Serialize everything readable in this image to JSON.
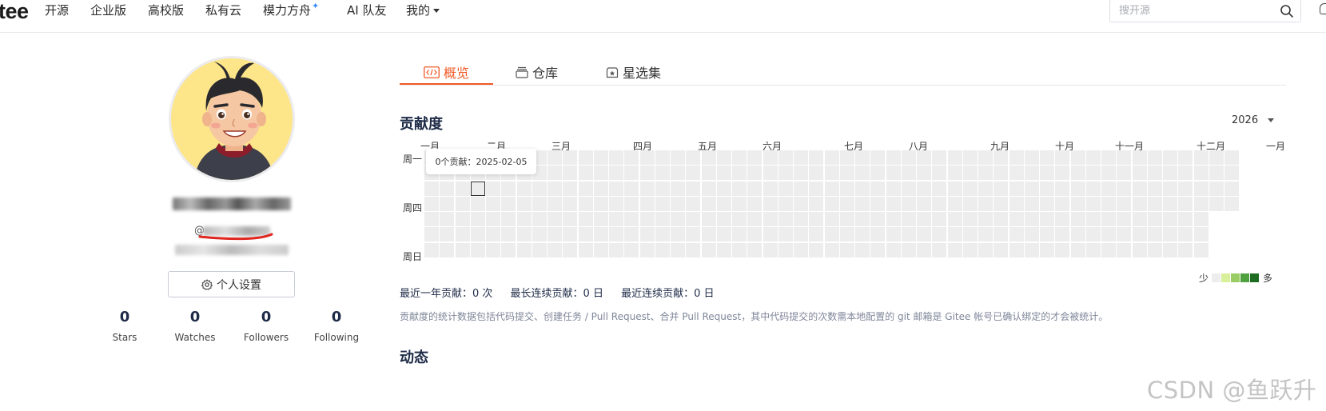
{
  "header": {
    "logo": "tee",
    "nav": [
      {
        "label": "开源"
      },
      {
        "label": "企业版"
      },
      {
        "label": "高校版"
      },
      {
        "label": "私有云"
      },
      {
        "label": "模力方舟"
      },
      {
        "label": "AI 队友"
      },
      {
        "label": "我的"
      }
    ],
    "search": {
      "placeholder": "搜开源"
    }
  },
  "profile": {
    "handle_prefix": "@",
    "settings_label": "个人设置",
    "stats": [
      {
        "value": "0",
        "label": "Stars"
      },
      {
        "value": "0",
        "label": "Watches"
      },
      {
        "value": "0",
        "label": "Followers"
      },
      {
        "value": "0",
        "label": "Following"
      }
    ]
  },
  "tabs": [
    {
      "label": "概览",
      "active": true
    },
    {
      "label": "仓库",
      "active": false
    },
    {
      "label": "星选集",
      "active": false
    }
  ],
  "contributions": {
    "title": "贡献度",
    "year": "2026",
    "months": [
      "一月",
      "二月",
      "三月",
      "四月",
      "五月",
      "六月",
      "七月",
      "八月",
      "九月",
      "十月",
      "十一月",
      "十二月",
      "一月"
    ],
    "weekdays": [
      "周一",
      "周四",
      "周日"
    ],
    "tooltip": "0个贡献：2025-02-05",
    "legend_less": "少",
    "legend_more": "多",
    "legend_colors": [
      "#ededed",
      "#d8ef9c",
      "#9acd63",
      "#4fa140",
      "#1e6b22"
    ],
    "summary": {
      "yearly": "最近一年贡献：0 次",
      "longest": "最长连续贡献：0 日",
      "recent": "最近连续贡献：0 日"
    },
    "note": "贡献度的统计数据包括代码提交、创建任务 / Pull Request、合并 Pull Request，其中代码提交的次数需本地配置的 git 邮箱是 Gitee 帐号已确认绑定的才会被统计。"
  },
  "activity": {
    "title": "动态"
  },
  "watermark": "CSDN @鱼跃升"
}
